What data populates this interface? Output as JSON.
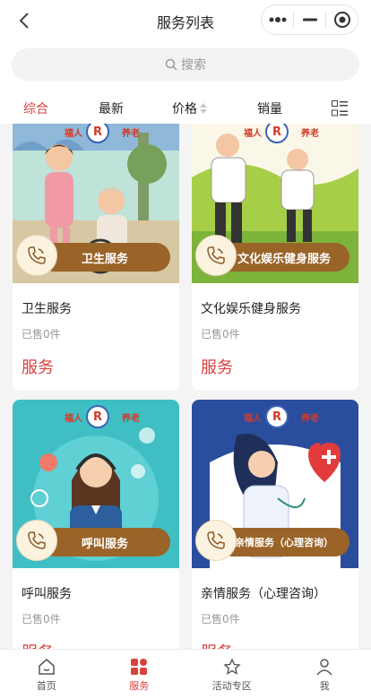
{
  "header": {
    "title": "服务列表"
  },
  "search": {
    "placeholder": "搜索"
  },
  "sort": {
    "items": [
      "综合",
      "最新",
      "价格",
      "销量"
    ],
    "active": "综合"
  },
  "brand": {
    "left": "福人",
    "logo": "R",
    "right": "养老"
  },
  "cards": [
    {
      "name": "卫生服务",
      "ribbon": "卫生服务",
      "sold": "已售0件",
      "tag": "服务"
    },
    {
      "name": "文化娱乐健身服务",
      "ribbon": "文化娱乐健身服务",
      "sold": "已售0件",
      "tag": "服务"
    },
    {
      "name": "呼叫服务",
      "ribbon": "呼叫服务",
      "sold": "已售0件",
      "tag": "服务"
    },
    {
      "name": "亲情服务（心理咨询）",
      "ribbon": "亲情服务（心理咨询）",
      "sold": "已售0件",
      "tag": "服务"
    }
  ],
  "tabbar": {
    "items": [
      {
        "label": "首页",
        "icon": "home-icon"
      },
      {
        "label": "服务",
        "icon": "grid-icon"
      },
      {
        "label": "活动专区",
        "icon": "star-icon"
      },
      {
        "label": "我",
        "icon": "user-icon"
      }
    ],
    "active": "服务"
  },
  "colors": {
    "accent": "#d9413d",
    "ribbon": "#9a6428"
  }
}
